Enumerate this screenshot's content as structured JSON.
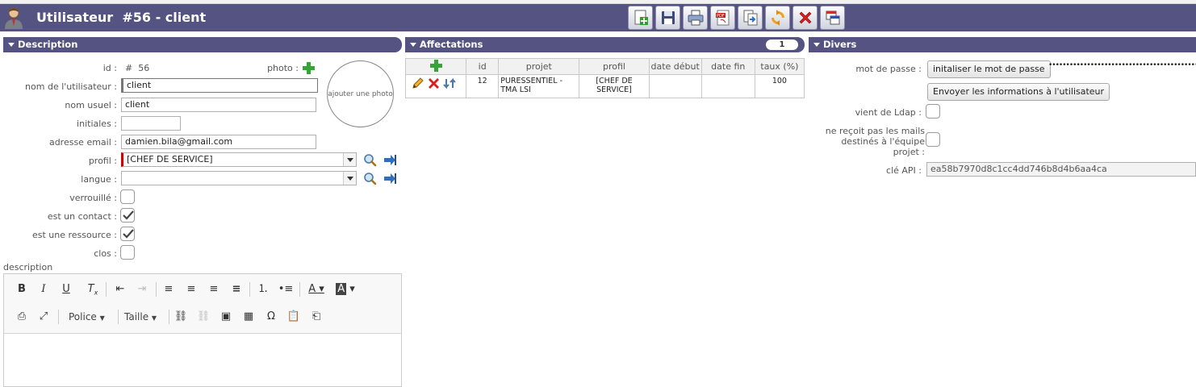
{
  "header": {
    "title": "Utilisateur  #56 - client"
  },
  "toolbar": [
    "new-icon",
    "save-icon",
    "print-icon",
    "pdf-icon",
    "copy-icon",
    "refresh-icon",
    "delete-icon",
    "window-icon"
  ],
  "description": {
    "title": "Description",
    "id_label": "id :",
    "id_value": "#  56",
    "photo_label": "photo :",
    "photo_placeholder": "ajouter une photo",
    "name_label": "nom de l'utilisateur :",
    "name_value": "client",
    "usual_label": "nom usuel :",
    "usual_value": "client",
    "initials_label": "initiales :",
    "initials_value": "",
    "email_label": "adresse email :",
    "email_value": "damien.bila@gmail.com",
    "profile_label": "profil :",
    "profile_value": "[CHEF DE SERVICE]",
    "lang_label": "langue :",
    "lang_value": "",
    "locked_label": "verrouillé :",
    "contact_label": "est un contact :",
    "resource_label": "est une ressource :",
    "closed_label": "clos :",
    "desc_label": "description",
    "checks": {
      "locked": false,
      "contact": true,
      "resource": true,
      "closed": false
    }
  },
  "editor": {
    "font_label": "Police",
    "size_label": "Taille"
  },
  "affectations": {
    "title": "Affectations",
    "count": "1",
    "columns": [
      "id",
      "projet",
      "profil",
      "date début",
      "date fin",
      "taux (%)"
    ],
    "rows": [
      {
        "id": "12",
        "projet": "PURESSENTIEL - TMA LSI",
        "profil": "[CHEF DE SERVICE]",
        "debut": "",
        "fin": "",
        "taux": "100"
      }
    ]
  },
  "divers": {
    "title": "Divers",
    "password_label": "mot de passe :",
    "init_password_button": "initaliser le mot de passe",
    "password_dots": "••••••••••••••••••••••••••••••••••••••••••••",
    "send_info_button": "Envoyer les informations à l'utilisateur",
    "ldap_label": "vient de Ldap :",
    "nomail_label_1": "ne reçoit pas les mails",
    "nomail_label_2": "destinés à l'équipe",
    "nomail_label_3": "projet :",
    "api_label": "clé API :",
    "api_value": "ea58b7970d8c1cc4dd746b8d4b6aa4ca"
  }
}
